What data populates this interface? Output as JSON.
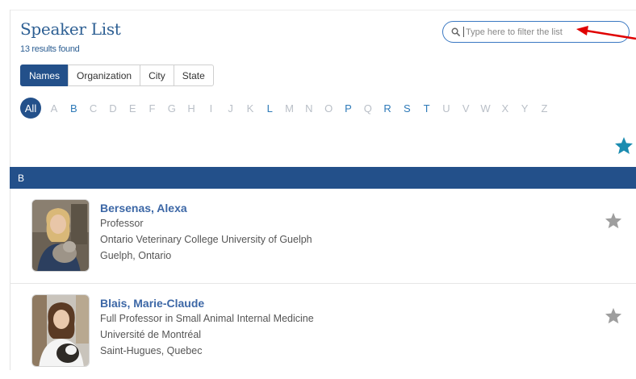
{
  "page": {
    "title": "Speaker List",
    "results_count": "13 results found"
  },
  "search": {
    "placeholder": "Type here to filter the list",
    "value": ""
  },
  "filter_tabs": [
    {
      "label": "Names",
      "active": true
    },
    {
      "label": "Organization",
      "active": false
    },
    {
      "label": "City",
      "active": false
    },
    {
      "label": "State",
      "active": false
    }
  ],
  "alphabet": {
    "all_label": "All",
    "letters": [
      "A",
      "B",
      "C",
      "D",
      "E",
      "F",
      "G",
      "H",
      "I",
      "J",
      "K",
      "L",
      "M",
      "N",
      "O",
      "P",
      "Q",
      "R",
      "S",
      "T",
      "U",
      "V",
      "W",
      "X",
      "Y",
      "Z"
    ],
    "enabled": [
      "B",
      "L",
      "P",
      "R",
      "S",
      "T"
    ]
  },
  "favorites_icon": "star-icon",
  "section": {
    "letter": "B"
  },
  "speakers": [
    {
      "name": "Bersenas, Alexa",
      "title": "Professor",
      "organization": "Ontario Veterinary College University of Guelph",
      "location": "Guelph, Ontario"
    },
    {
      "name": "Blais, Marie-Claude",
      "title": "Full Professor in Small Animal Internal Medicine",
      "organization": "Université de Montréal",
      "location": "Saint-Hugues, Quebec"
    }
  ],
  "colors": {
    "primary": "#23508a",
    "link": "#3c67a6",
    "letter_enabled": "#2e7ab8",
    "letter_disabled": "#b9bfc7",
    "favorites_star": "#1b8cb0",
    "speaker_star": "#9e9e9e",
    "annotation_arrow": "#e00000"
  }
}
